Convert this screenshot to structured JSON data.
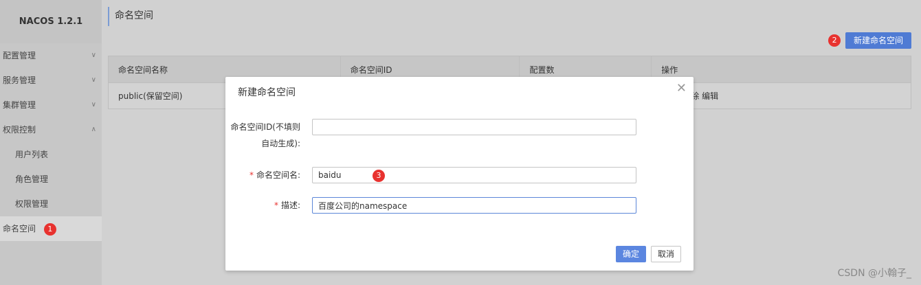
{
  "app": {
    "title": "NACOS 1.2.1"
  },
  "sidebar": {
    "items": [
      {
        "label": "配置管理",
        "chevron": "∨"
      },
      {
        "label": "服务管理",
        "chevron": "∨"
      },
      {
        "label": "集群管理",
        "chevron": "∨"
      },
      {
        "label": "权限控制",
        "chevron": "∧"
      },
      {
        "label": "用户列表"
      },
      {
        "label": "角色管理"
      },
      {
        "label": "权限管理"
      },
      {
        "label": "命名空间",
        "badge": "1",
        "active": true
      }
    ]
  },
  "page": {
    "title": "命名空间"
  },
  "toolbar": {
    "badge": "2",
    "new_label": "新建命名空间"
  },
  "table": {
    "columns": [
      "命名空间名称",
      "命名空间ID",
      "配置数",
      "操作"
    ],
    "rows": [
      {
        "name": "public(保留空间)",
        "id": "",
        "count": "",
        "actions": "除  编辑"
      }
    ]
  },
  "dialog": {
    "title": "新建命名空间",
    "close_icon": "close-icon",
    "fields": {
      "id": {
        "label_line1": "命名空间ID(不填则",
        "label_line2": "自动生成):",
        "value": ""
      },
      "name": {
        "required": "*",
        "label": "命名空间名:",
        "value": "baidu",
        "badge": "3"
      },
      "desc": {
        "required": "*",
        "label": "描述:",
        "value": "百度公司的namespace"
      }
    },
    "ok_label": "确定",
    "cancel_label": "取消"
  },
  "watermark": "CSDN @小翰子_",
  "colors": {
    "primary": "#4f7bd4",
    "badge": "#e8322f"
  }
}
